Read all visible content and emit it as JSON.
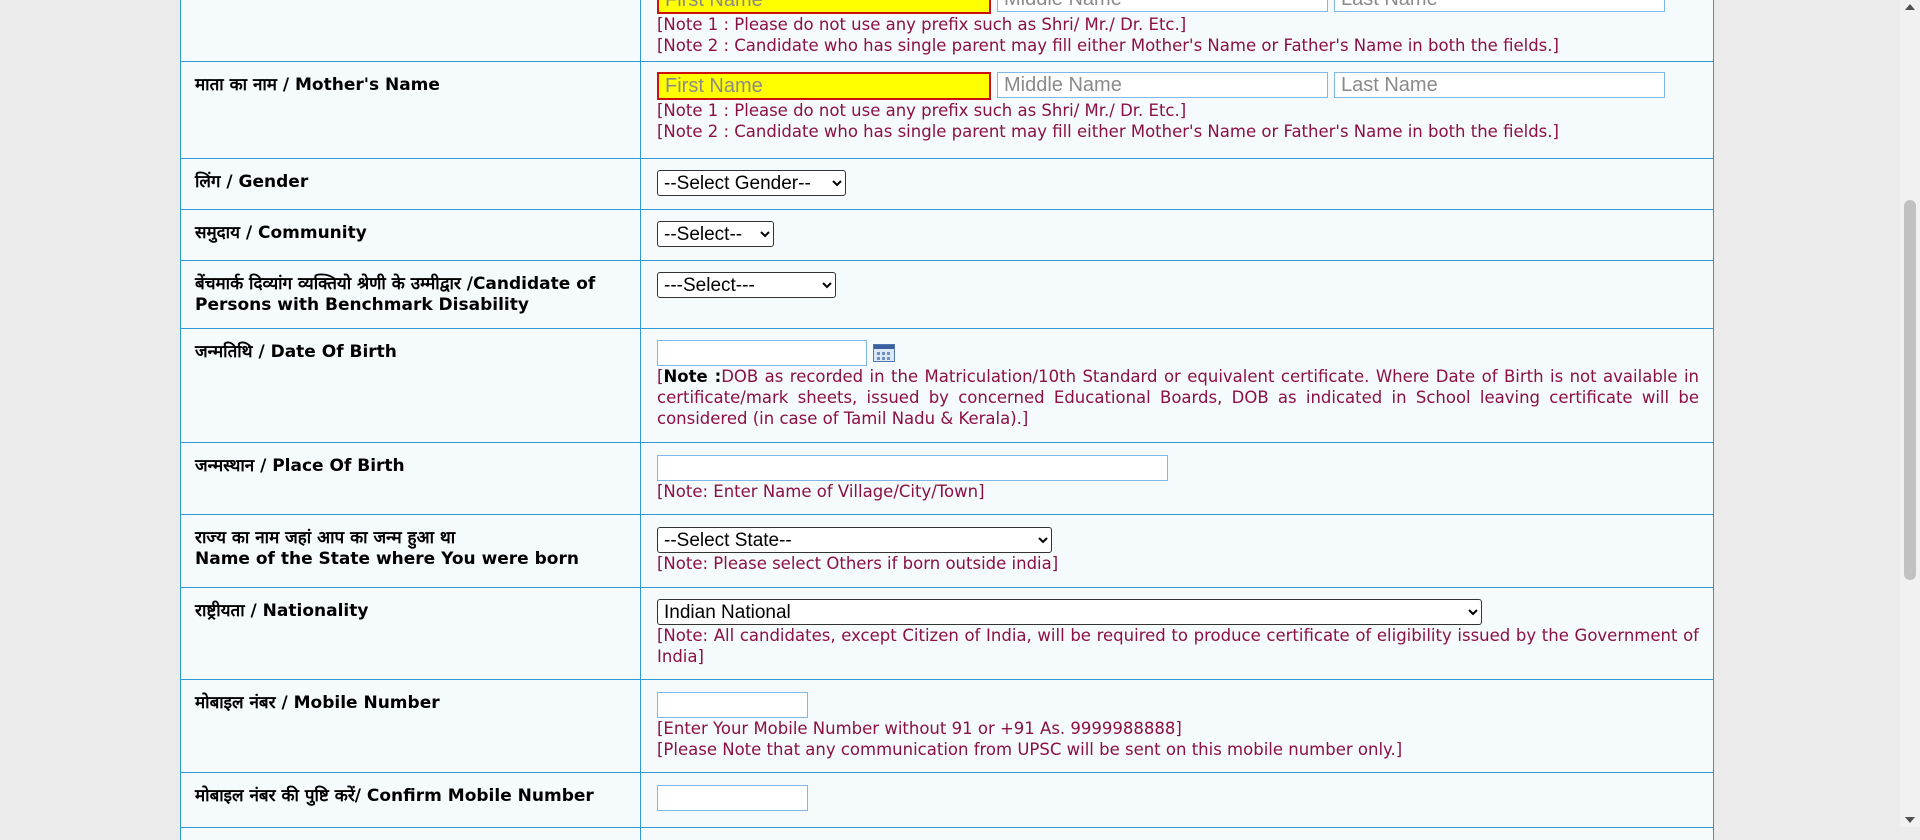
{
  "father_partial": {
    "placeholders": {
      "first": "First Name",
      "middle": "Middle Name",
      "last": "Last Name"
    },
    "notes": [
      "[Note 1 : Please do not use any prefix such as Shri/ Mr./ Dr. Etc.]",
      "[Note 2 : Candidate who has single parent may fill either Mother's Name or Father's Name in both the fields.]"
    ]
  },
  "mother": {
    "label": "माता का नाम / Mother's Name",
    "placeholders": {
      "first": "First Name",
      "middle": "Middle Name",
      "last": "Last Name"
    },
    "notes": [
      "[Note 1 : Please do not use any prefix such as Shri/ Mr./ Dr. Etc.]",
      "[Note 2 : Candidate who has single parent may fill either Mother's Name or Father's Name in both the fields.]"
    ]
  },
  "gender": {
    "label": "लिंग / Gender",
    "selected": "--Select Gender--"
  },
  "community": {
    "label": "समुदाय / Community",
    "selected": "--Select--"
  },
  "disability": {
    "label": "बेंचमार्क दिव्यांग व्यक्तियो श्रेणी के उम्मीद्वार /Candidate of Persons with Benchmark Disability",
    "selected": "---Select---"
  },
  "dob": {
    "label": "जन्मतिथि / Date Of Birth",
    "value": "",
    "note_prefix": "[",
    "note_bold": "Note :",
    "note_text": "DOB as recorded in the Matriculation/10th Standard or equivalent certificate. Where Date of Birth is not available in certificate/mark sheets, issued by concerned Educational Boards, DOB as indicated in School leaving certificate will be considered (in case of Tamil Nadu & Kerala).]"
  },
  "place_of_birth": {
    "label": "जन्मस्थान / Place Of Birth",
    "value": "",
    "note": "[Note: Enter Name of Village/City/Town]"
  },
  "birth_state": {
    "label_hi": "राज्य का नाम जहां आप का जन्म हुआ था",
    "label_en": "Name of the State where You were born",
    "selected": "--Select State--",
    "note": "[Note: Please select Others if born outside india]"
  },
  "nationality": {
    "label": "राष्ट्रीयता / Nationality",
    "selected": "Indian National",
    "note": "[Note: All candidates, except Citizen of India, will be required to produce certificate of eligibility issued by the Government of India]"
  },
  "mobile": {
    "label": "मोबाइल नंबर / Mobile Number",
    "value": "",
    "notes": [
      "[Enter Your Mobile Number without 91 or +91 As. 9999988888]",
      "[Please Note that any communication from UPSC will be sent on this mobile number only.]"
    ]
  },
  "confirm_mobile": {
    "label": "मोबाइल नंबर की पुष्टि करें/ Confirm Mobile Number",
    "value": ""
  }
}
